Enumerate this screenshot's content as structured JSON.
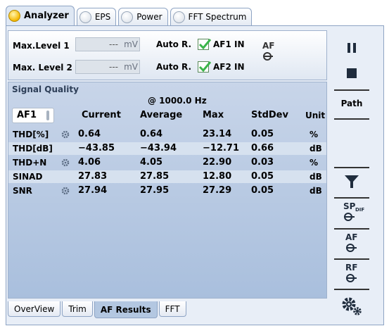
{
  "top_tabs": [
    {
      "label": "Analyzer",
      "active": true,
      "led": "on"
    },
    {
      "label": "EPS",
      "active": false,
      "led": "off"
    },
    {
      "label": "Power",
      "active": false,
      "led": "off"
    },
    {
      "label": "FFT Spectrum",
      "active": false,
      "led": "off"
    }
  ],
  "levels": [
    {
      "label": "Max.Level 1",
      "value": "---",
      "unit": "mV",
      "auto": "Auto R.",
      "checkbox_label": "AF1 IN",
      "checked": true
    },
    {
      "label": "Max. Level 2",
      "value": "---",
      "unit": "mV",
      "auto": "Auto R.",
      "checkbox_label": "AF2 IN",
      "checked": true
    }
  ],
  "af_icon_label": "AF",
  "signal_quality": {
    "title": "Signal Quality",
    "frequency": "@ 1000.0 Hz",
    "selector": "AF1",
    "columns": [
      "Current",
      "Average",
      "Max",
      "StdDev",
      "Unit"
    ],
    "rows": [
      {
        "name": "THD[%]",
        "gear": true,
        "current": "0.64",
        "average": "0.64",
        "max": "23.14",
        "stddev": "0.05",
        "unit": "%"
      },
      {
        "name": "THD[dB]",
        "gear": false,
        "current": "−43.85",
        "average": "−43.94",
        "max": "−12.71",
        "stddev": "0.66",
        "unit": "dB"
      },
      {
        "name": "THD+N",
        "gear": true,
        "current": "4.06",
        "average": "4.05",
        "max": "22.90",
        "stddev": "0.03",
        "unit": "%"
      },
      {
        "name": "SINAD",
        "gear": false,
        "current": "27.83",
        "average": "27.85",
        "max": "12.80",
        "stddev": "0.05",
        "unit": "dB"
      },
      {
        "name": "SNR",
        "gear": true,
        "current": "27.94",
        "average": "27.95",
        "max": "27.29",
        "stddev": "0.05",
        "unit": "dB"
      }
    ]
  },
  "bottom_tabs": [
    {
      "label": "OverView",
      "active": false
    },
    {
      "label": "Trim",
      "active": false
    },
    {
      "label": "AF Results",
      "active": true
    },
    {
      "label": "FFT",
      "active": false
    }
  ],
  "sidebar": {
    "pause_icon": "pause-icon",
    "stop_icon": "stop-icon",
    "path_label": "Path",
    "filter_icon": "filter-icon",
    "spdif_label": "SP",
    "spdif_sub": "DIF",
    "af_label": "AF",
    "rf_label": "RF",
    "settings_icon": "gears-icon"
  },
  "colors": {
    "accent_green": "#3bb54a",
    "led_on": "#f5b700",
    "panel_blue": "#b3c7e1"
  }
}
